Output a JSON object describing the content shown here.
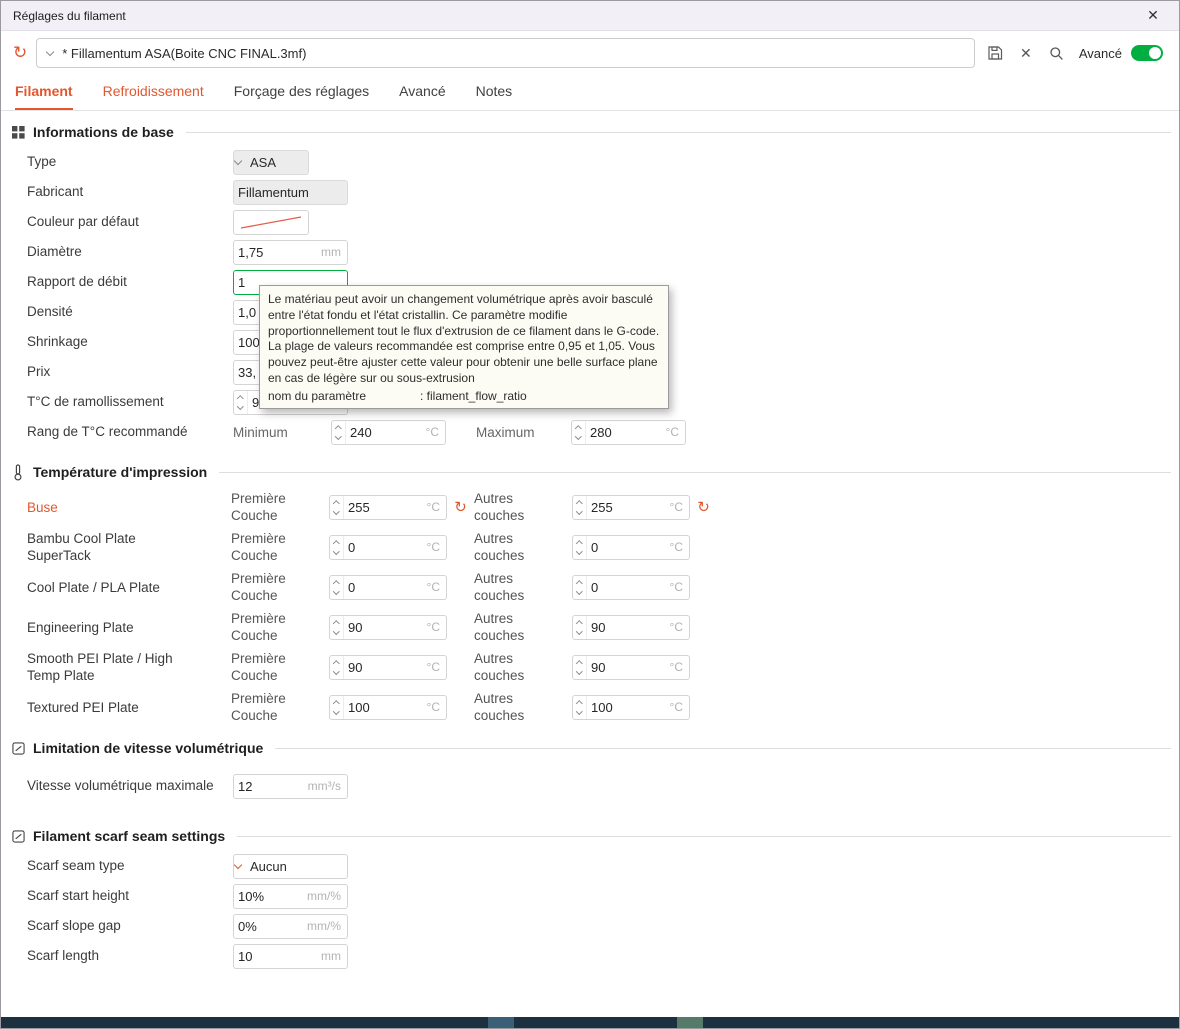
{
  "window": {
    "title": "Réglages du filament",
    "close_glyph": "✕"
  },
  "toolbar": {
    "refresh_glyph": "↻",
    "preset_value": "* Fillamentum ASA(Boite CNC FINAL.3mf)",
    "delete_glyph": "✕",
    "advanced_label": "Avancé"
  },
  "tabs": {
    "filament": "Filament",
    "cooling": "Refroidissement",
    "overrides": "Forçage des réglages",
    "advanced": "Avancé",
    "notes": "Notes"
  },
  "basic": {
    "title": "Informations de base",
    "type": {
      "label": "Type",
      "value": "ASA"
    },
    "vendor": {
      "label": "Fabricant",
      "value": "Fillamentum"
    },
    "color": {
      "label": "Couleur par défaut"
    },
    "diameter": {
      "label": "Diamètre",
      "value": "1,75",
      "unit": "mm"
    },
    "flow": {
      "label": "Rapport de débit",
      "value": "1"
    },
    "density": {
      "label": "Densité",
      "value": "1,0"
    },
    "shrinkage": {
      "label": "Shrinkage",
      "value": "100"
    },
    "price": {
      "label": "Prix",
      "value": "33,"
    },
    "softening": {
      "label": "T°C de ramollissement",
      "value": "93"
    },
    "range": {
      "label": "Rang de T°C recommandé",
      "min_label": "Minimum",
      "min_value": "240",
      "max_label": "Maximum",
      "max_value": "280",
      "unit": "°C"
    }
  },
  "tooltip": {
    "body": "Le matériau peut avoir un changement volumétrique après avoir basculé entre l'état fondu et l'état cristallin. Ce paramètre modifie proportionnellement tout le flux d'extrusion de ce filament dans le G-code. La plage de valeurs recommandée est comprise entre 0,95 et 1,05. Vous pouvez peut-être ajuster cette valeur pour obtenir une belle surface plane en cas de légère sur ou sous-extrusion",
    "param_label": "nom du paramètre",
    "param_value": ": filament_flow_ratio"
  },
  "temps": {
    "title": "Température d'impression",
    "first_label": "Première Couche",
    "other_label": "Autres couches",
    "unit": "°C",
    "reset_glyph": "↻",
    "rows": [
      {
        "label": "Buse",
        "first": "255",
        "other": "255"
      },
      {
        "label": "Bambu Cool Plate SuperTack",
        "first": "0",
        "other": "0"
      },
      {
        "label": "Cool Plate / PLA Plate",
        "first": "0",
        "other": "0"
      },
      {
        "label": "Engineering Plate",
        "first": "90",
        "other": "90"
      },
      {
        "label": "Smooth PEI Plate / High Temp Plate",
        "first": "90",
        "other": "90"
      },
      {
        "label": "Textured PEI Plate",
        "first": "100",
        "other": "100"
      }
    ]
  },
  "volumetric": {
    "title": "Limitation de vitesse volumétrique",
    "label": "Vitesse volumétrique maximale",
    "value": "12",
    "unit": "mm³/s"
  },
  "scarf": {
    "title": "Filament scarf seam settings",
    "type": {
      "label": "Scarf seam type",
      "value": "Aucun"
    },
    "start": {
      "label": "Scarf start height",
      "value": "10%",
      "unit": "mm/%"
    },
    "gap": {
      "label": "Scarf slope gap",
      "value": "0%",
      "unit": "mm/%"
    },
    "length": {
      "label": "Scarf length",
      "value": "10",
      "unit": "mm"
    }
  },
  "colors": {
    "accent_orange": "#e2572f",
    "accent_green": "#00ae42"
  }
}
